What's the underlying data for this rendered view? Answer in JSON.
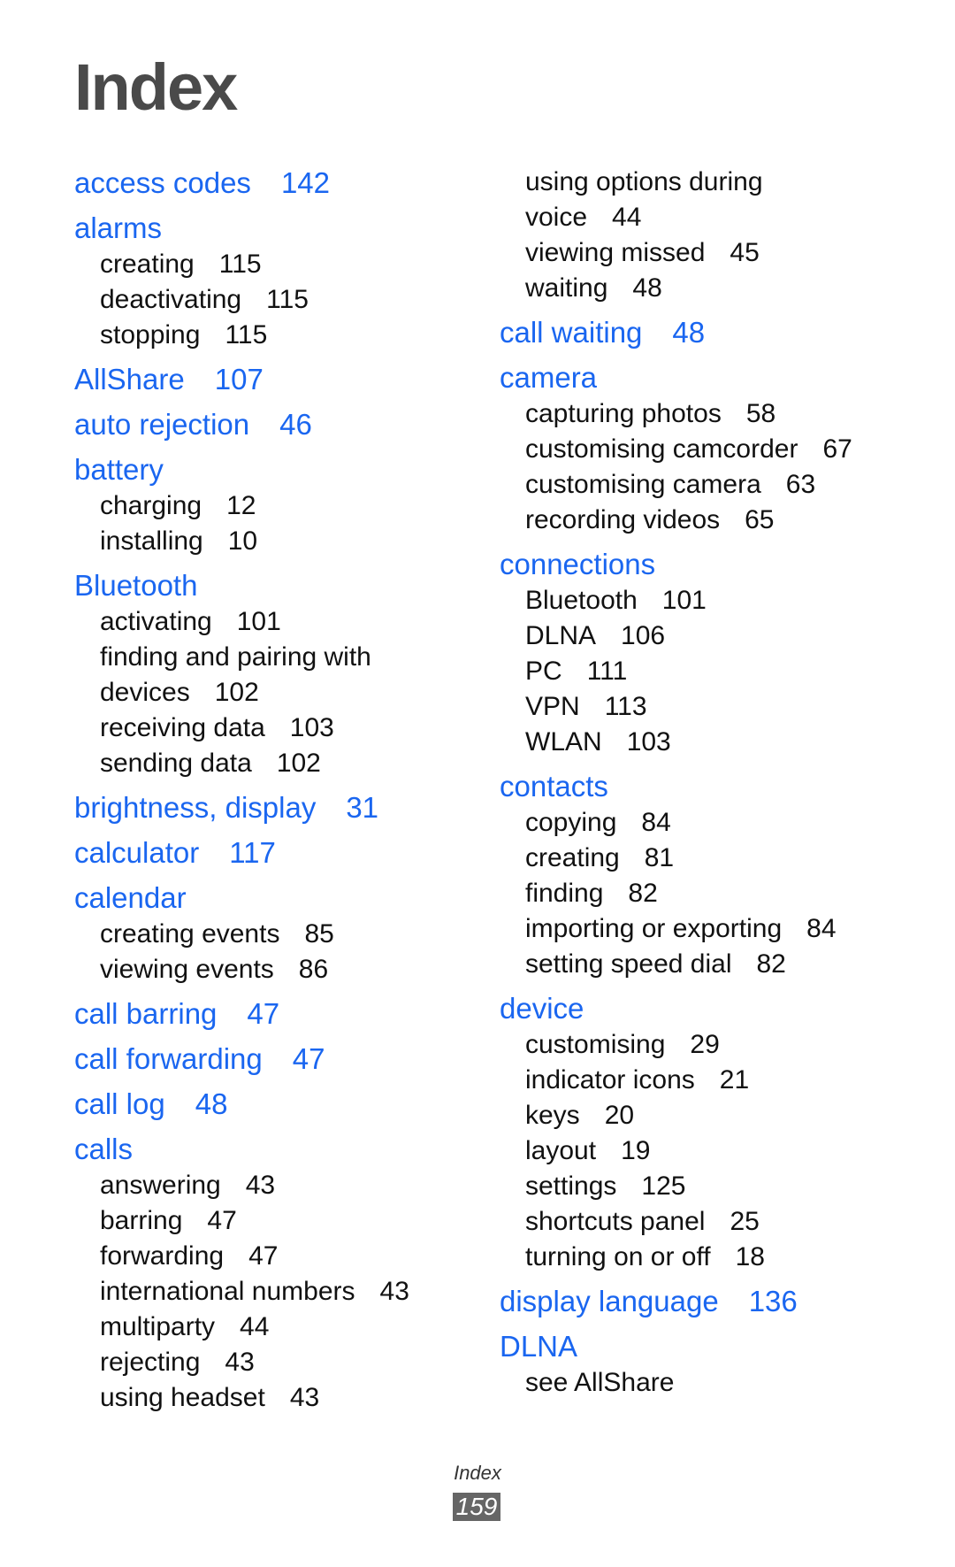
{
  "page_title": "Index",
  "footer": {
    "section": "Index",
    "page_number": "159"
  },
  "colors": {
    "heading": "#1a66f0",
    "title": "#4a4a4a",
    "text": "#111111",
    "page_box": "#666666"
  },
  "left_column": [
    {
      "term": "access codes",
      "page": "142"
    },
    {
      "term": "alarms",
      "subs": [
        {
          "term": "creating",
          "page": "115"
        },
        {
          "term": "deactivating",
          "page": "115"
        },
        {
          "term": "stopping",
          "page": "115"
        }
      ]
    },
    {
      "term": "AllShare",
      "page": "107"
    },
    {
      "term": "auto rejection",
      "page": "46"
    },
    {
      "term": "battery",
      "subs": [
        {
          "term": "charging",
          "page": "12"
        },
        {
          "term": "installing",
          "page": "10"
        }
      ]
    },
    {
      "term": "Bluetooth",
      "subs": [
        {
          "term": "activating",
          "page": "101"
        },
        {
          "term": "finding and pairing with",
          "cont": "devices",
          "page": "102"
        },
        {
          "term": "receiving data",
          "page": "103"
        },
        {
          "term": "sending data",
          "page": "102"
        }
      ]
    },
    {
      "term": "brightness, display",
      "page": "31"
    },
    {
      "term": "calculator",
      "page": "117"
    },
    {
      "term": "calendar",
      "subs": [
        {
          "term": "creating events",
          "page": "85"
        },
        {
          "term": "viewing events",
          "page": "86"
        }
      ]
    },
    {
      "term": "call barring",
      "page": "47"
    },
    {
      "term": "call forwarding",
      "page": "47"
    },
    {
      "term": "call log",
      "page": "48"
    },
    {
      "term": "calls",
      "subs": [
        {
          "term": "answering",
          "page": "43"
        },
        {
          "term": "barring",
          "page": "47"
        },
        {
          "term": "forwarding",
          "page": "47"
        },
        {
          "term": "international numbers",
          "page": "43"
        },
        {
          "term": "multiparty",
          "page": "44"
        },
        {
          "term": "rejecting",
          "page": "43"
        },
        {
          "term": "using headset",
          "page": "43"
        }
      ]
    }
  ],
  "right_column": [
    {
      "continued_subs": [
        {
          "term": "using options during",
          "cont": "voice",
          "page": "44"
        },
        {
          "term": "viewing missed",
          "page": "45"
        },
        {
          "term": "waiting",
          "page": "48"
        }
      ]
    },
    {
      "term": "call waiting",
      "page": "48"
    },
    {
      "term": "camera",
      "subs": [
        {
          "term": "capturing photos",
          "page": "58"
        },
        {
          "term": "customising camcorder",
          "page": "67"
        },
        {
          "term": "customising camera",
          "page": "63"
        },
        {
          "term": "recording videos",
          "page": "65"
        }
      ]
    },
    {
      "term": "connections",
      "subs": [
        {
          "term": "Bluetooth",
          "page": "101"
        },
        {
          "term": "DLNA",
          "page": "106"
        },
        {
          "term": "PC",
          "page": "111"
        },
        {
          "term": "VPN",
          "page": "113"
        },
        {
          "term": "WLAN",
          "page": "103"
        }
      ]
    },
    {
      "term": "contacts",
      "subs": [
        {
          "term": "copying",
          "page": "84"
        },
        {
          "term": "creating",
          "page": "81"
        },
        {
          "term": "finding",
          "page": "82"
        },
        {
          "term": "importing or exporting",
          "page": "84"
        },
        {
          "term": "setting speed dial",
          "page": "82"
        }
      ]
    },
    {
      "term": "device",
      "subs": [
        {
          "term": "customising",
          "page": "29"
        },
        {
          "term": "indicator icons",
          "page": "21"
        },
        {
          "term": "keys",
          "page": "20"
        },
        {
          "term": "layout",
          "page": "19"
        },
        {
          "term": "settings",
          "page": "125"
        },
        {
          "term": "shortcuts panel",
          "page": "25"
        },
        {
          "term": "turning on or off",
          "page": "18"
        }
      ]
    },
    {
      "term": "display language",
      "page": "136"
    },
    {
      "term": "DLNA",
      "subs": [
        {
          "term": "see AllShare"
        }
      ]
    }
  ]
}
